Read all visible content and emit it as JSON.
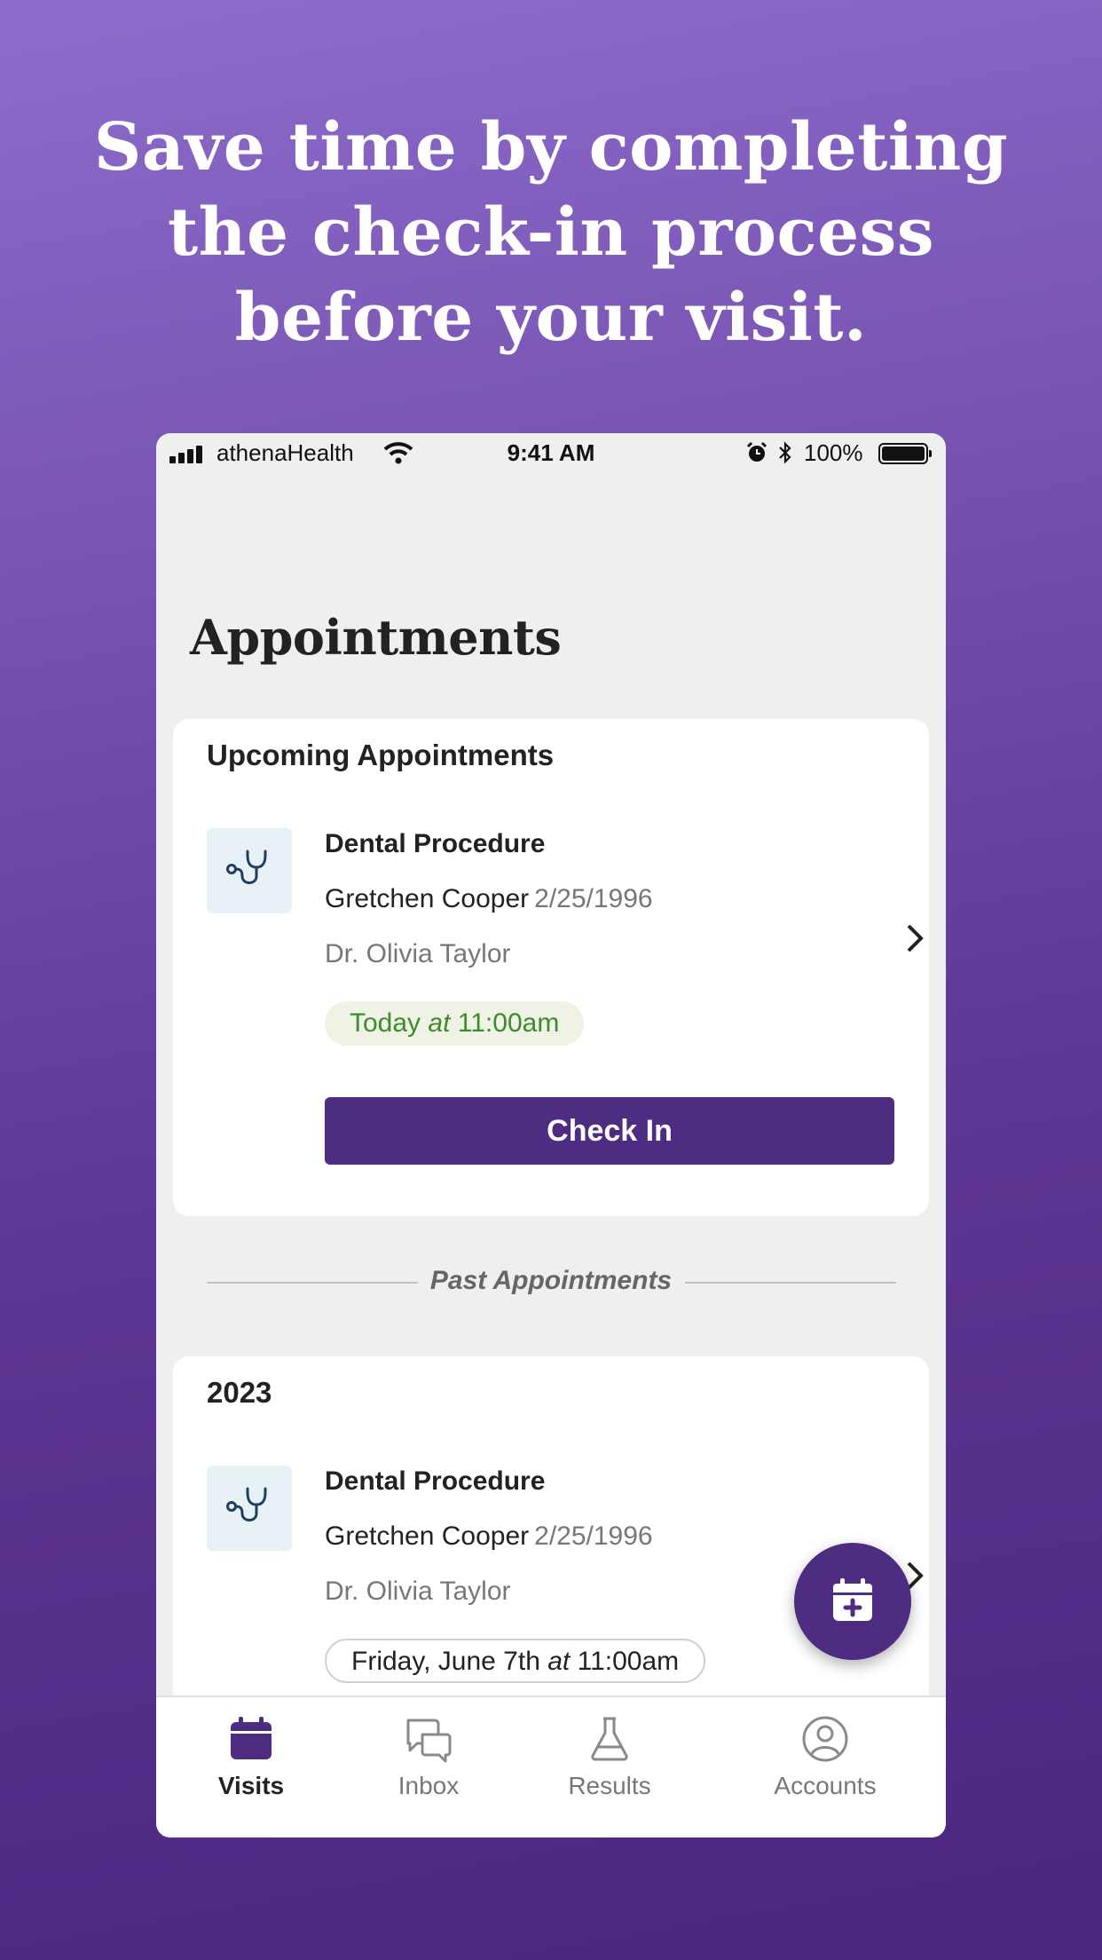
{
  "headline": {
    "line1": "Save time by completing",
    "line2": "the check-in process",
    "line3": "before your visit."
  },
  "status_bar": {
    "carrier": "athenaHealth",
    "time": "9:41 AM",
    "battery": "100%"
  },
  "page": {
    "title": "Appointments"
  },
  "upcoming": {
    "heading": "Upcoming Appointments",
    "appointment": {
      "icon": "stethoscope-icon",
      "type": "Dental Procedure",
      "patient": "Gretchen Cooper",
      "dob": "2/25/1996",
      "doctor": "Dr. Olivia Taylor",
      "time_prefix": "Today",
      "time_at": "at",
      "time_value": "11:00am",
      "action": "Check In"
    }
  },
  "past": {
    "divider_label": "Past Appointments",
    "year": "2023",
    "appointment": {
      "icon": "stethoscope-icon",
      "type": "Dental Procedure",
      "patient": "Gretchen Cooper",
      "dob": "2/25/1996",
      "doctor": "Dr. Olivia Taylor",
      "time_prefix": "Friday, June 7th",
      "time_at": "at",
      "time_value": "11:00am"
    }
  },
  "fab": {
    "icon": "calendar-plus-icon"
  },
  "tabs": [
    {
      "label": "Visits",
      "icon": "calendar-icon",
      "active": true
    },
    {
      "label": "Inbox",
      "icon": "chat-icon",
      "active": false
    },
    {
      "label": "Results",
      "icon": "flask-icon",
      "active": false
    },
    {
      "label": "Accounts",
      "icon": "account-icon",
      "active": false
    }
  ],
  "colors": {
    "brand_purple": "#4e2c82",
    "today_green": "#3f8a2c",
    "today_pill_bg": "#eef3e6",
    "icon_bg": "#e8f1f5",
    "icon_stroke": "#1f3f62"
  }
}
